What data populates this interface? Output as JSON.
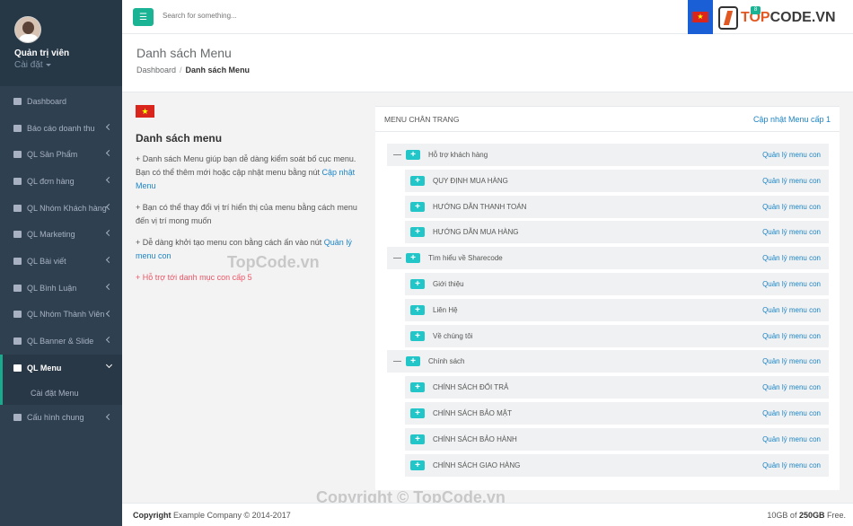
{
  "sidebar": {
    "user_name": "Quản trị viên",
    "user_sub": "Cài đặt",
    "items": [
      {
        "label": "Dashboard",
        "icon": "database-icon",
        "arrow": false
      },
      {
        "label": "Báo cáo doanh thu",
        "icon": "money-icon",
        "arrow": true
      },
      {
        "label": "QL Sản Phẩm",
        "icon": "cube-icon",
        "arrow": true
      },
      {
        "label": "QL đơn hàng",
        "icon": "shopping-bag-icon",
        "arrow": true
      },
      {
        "label": "QL Nhóm Khách hàng",
        "icon": "user-icon",
        "arrow": true
      },
      {
        "label": "QL Marketing",
        "icon": "money-icon",
        "arrow": true
      },
      {
        "label": "QL Bài viết",
        "icon": "file-icon",
        "arrow": true
      },
      {
        "label": "QL Bình Luận",
        "icon": "comment-icon",
        "arrow": true
      },
      {
        "label": "QL Nhóm Thành Viên",
        "icon": "user-icon",
        "arrow": true
      },
      {
        "label": "QL Banner & Slide",
        "icon": "image-icon",
        "arrow": true
      },
      {
        "label": "QL Menu",
        "icon": "list-icon",
        "arrow": true,
        "active": true
      },
      {
        "label": "Cấu hình chung",
        "icon": "file-icon",
        "arrow": true
      }
    ],
    "sub_item": "Cài đặt Menu"
  },
  "topbar": {
    "search_placeholder": "Search for something...",
    "badge": "8",
    "logo_top": "TOP",
    "logo_rest": "CODE.VN",
    "flag_star": "★"
  },
  "header": {
    "title": "Danh sách Menu",
    "breadcrumb_home": "Dashboard",
    "breadcrumb_sep": "/",
    "breadcrumb_current": "Danh sách Menu"
  },
  "info": {
    "flag_star": "★",
    "title": "Danh sách menu",
    "p1_text": "+ Danh sách Menu giúp bạn dễ dàng kiểm soát bố cục menu. Bạn có thể thêm mới hoặc cập nhật menu bằng nút ",
    "p1_link": "Cập nhật Menu",
    "p2_text": "+ Bạn có thể thay đổi vị trí hiển thị của menu bằng cách menu đến vị trí mong muốn",
    "p3_text": "+ Dễ dàng khởi tạo menu con bằng cách ấn vào nút ",
    "p3_link": "Quản lý menu con",
    "p4_text": "+ Hỗ trợ tới danh mục con cấp 5"
  },
  "panel": {
    "title": "MENU CHÂN TRANG",
    "action": "Cập nhật Menu cấp 1",
    "sub_link": "Quản lý menu con",
    "rows": [
      {
        "label": "Hỗ trợ khách hàng",
        "level": 1
      },
      {
        "label": "QUY ĐỊNH MUA HÀNG",
        "level": 2
      },
      {
        "label": "HƯỚNG DẪN THANH TOÁN",
        "level": 2
      },
      {
        "label": "HƯỚNG DẪN MUA HÀNG",
        "level": 2
      },
      {
        "label": "Tìm hiểu về Sharecode",
        "level": 1
      },
      {
        "label": "Giới thiệu",
        "level": 2
      },
      {
        "label": "Liên Hệ",
        "level": 2
      },
      {
        "label": "Về chúng tôi",
        "level": 2
      },
      {
        "label": "Chính sách",
        "level": 1
      },
      {
        "label": "CHÍNH SÁCH ĐỔI TRẢ",
        "level": 2
      },
      {
        "label": "CHÍNH SÁCH BẢO MẬT",
        "level": 2
      },
      {
        "label": "CHÍNH SÁCH BẢO HÀNH",
        "level": 2
      },
      {
        "label": "CHÍNH SÁCH GIAO HÀNG",
        "level": 2
      }
    ]
  },
  "watermark": {
    "mid": "TopCode.vn",
    "bottom": "Copyright © TopCode.vn"
  },
  "footer": {
    "left_bold": "Copyright",
    "left_text": " Example Company © 2014-2017",
    "right_used": "10GB of ",
    "right_total": "250GB",
    "right_suffix": " Free."
  },
  "colors": {
    "sidebar": "#2f4050",
    "accent": "#1ab394",
    "plus": "#23c6c8",
    "link": "#1c84c6",
    "red": "#ed5565"
  }
}
